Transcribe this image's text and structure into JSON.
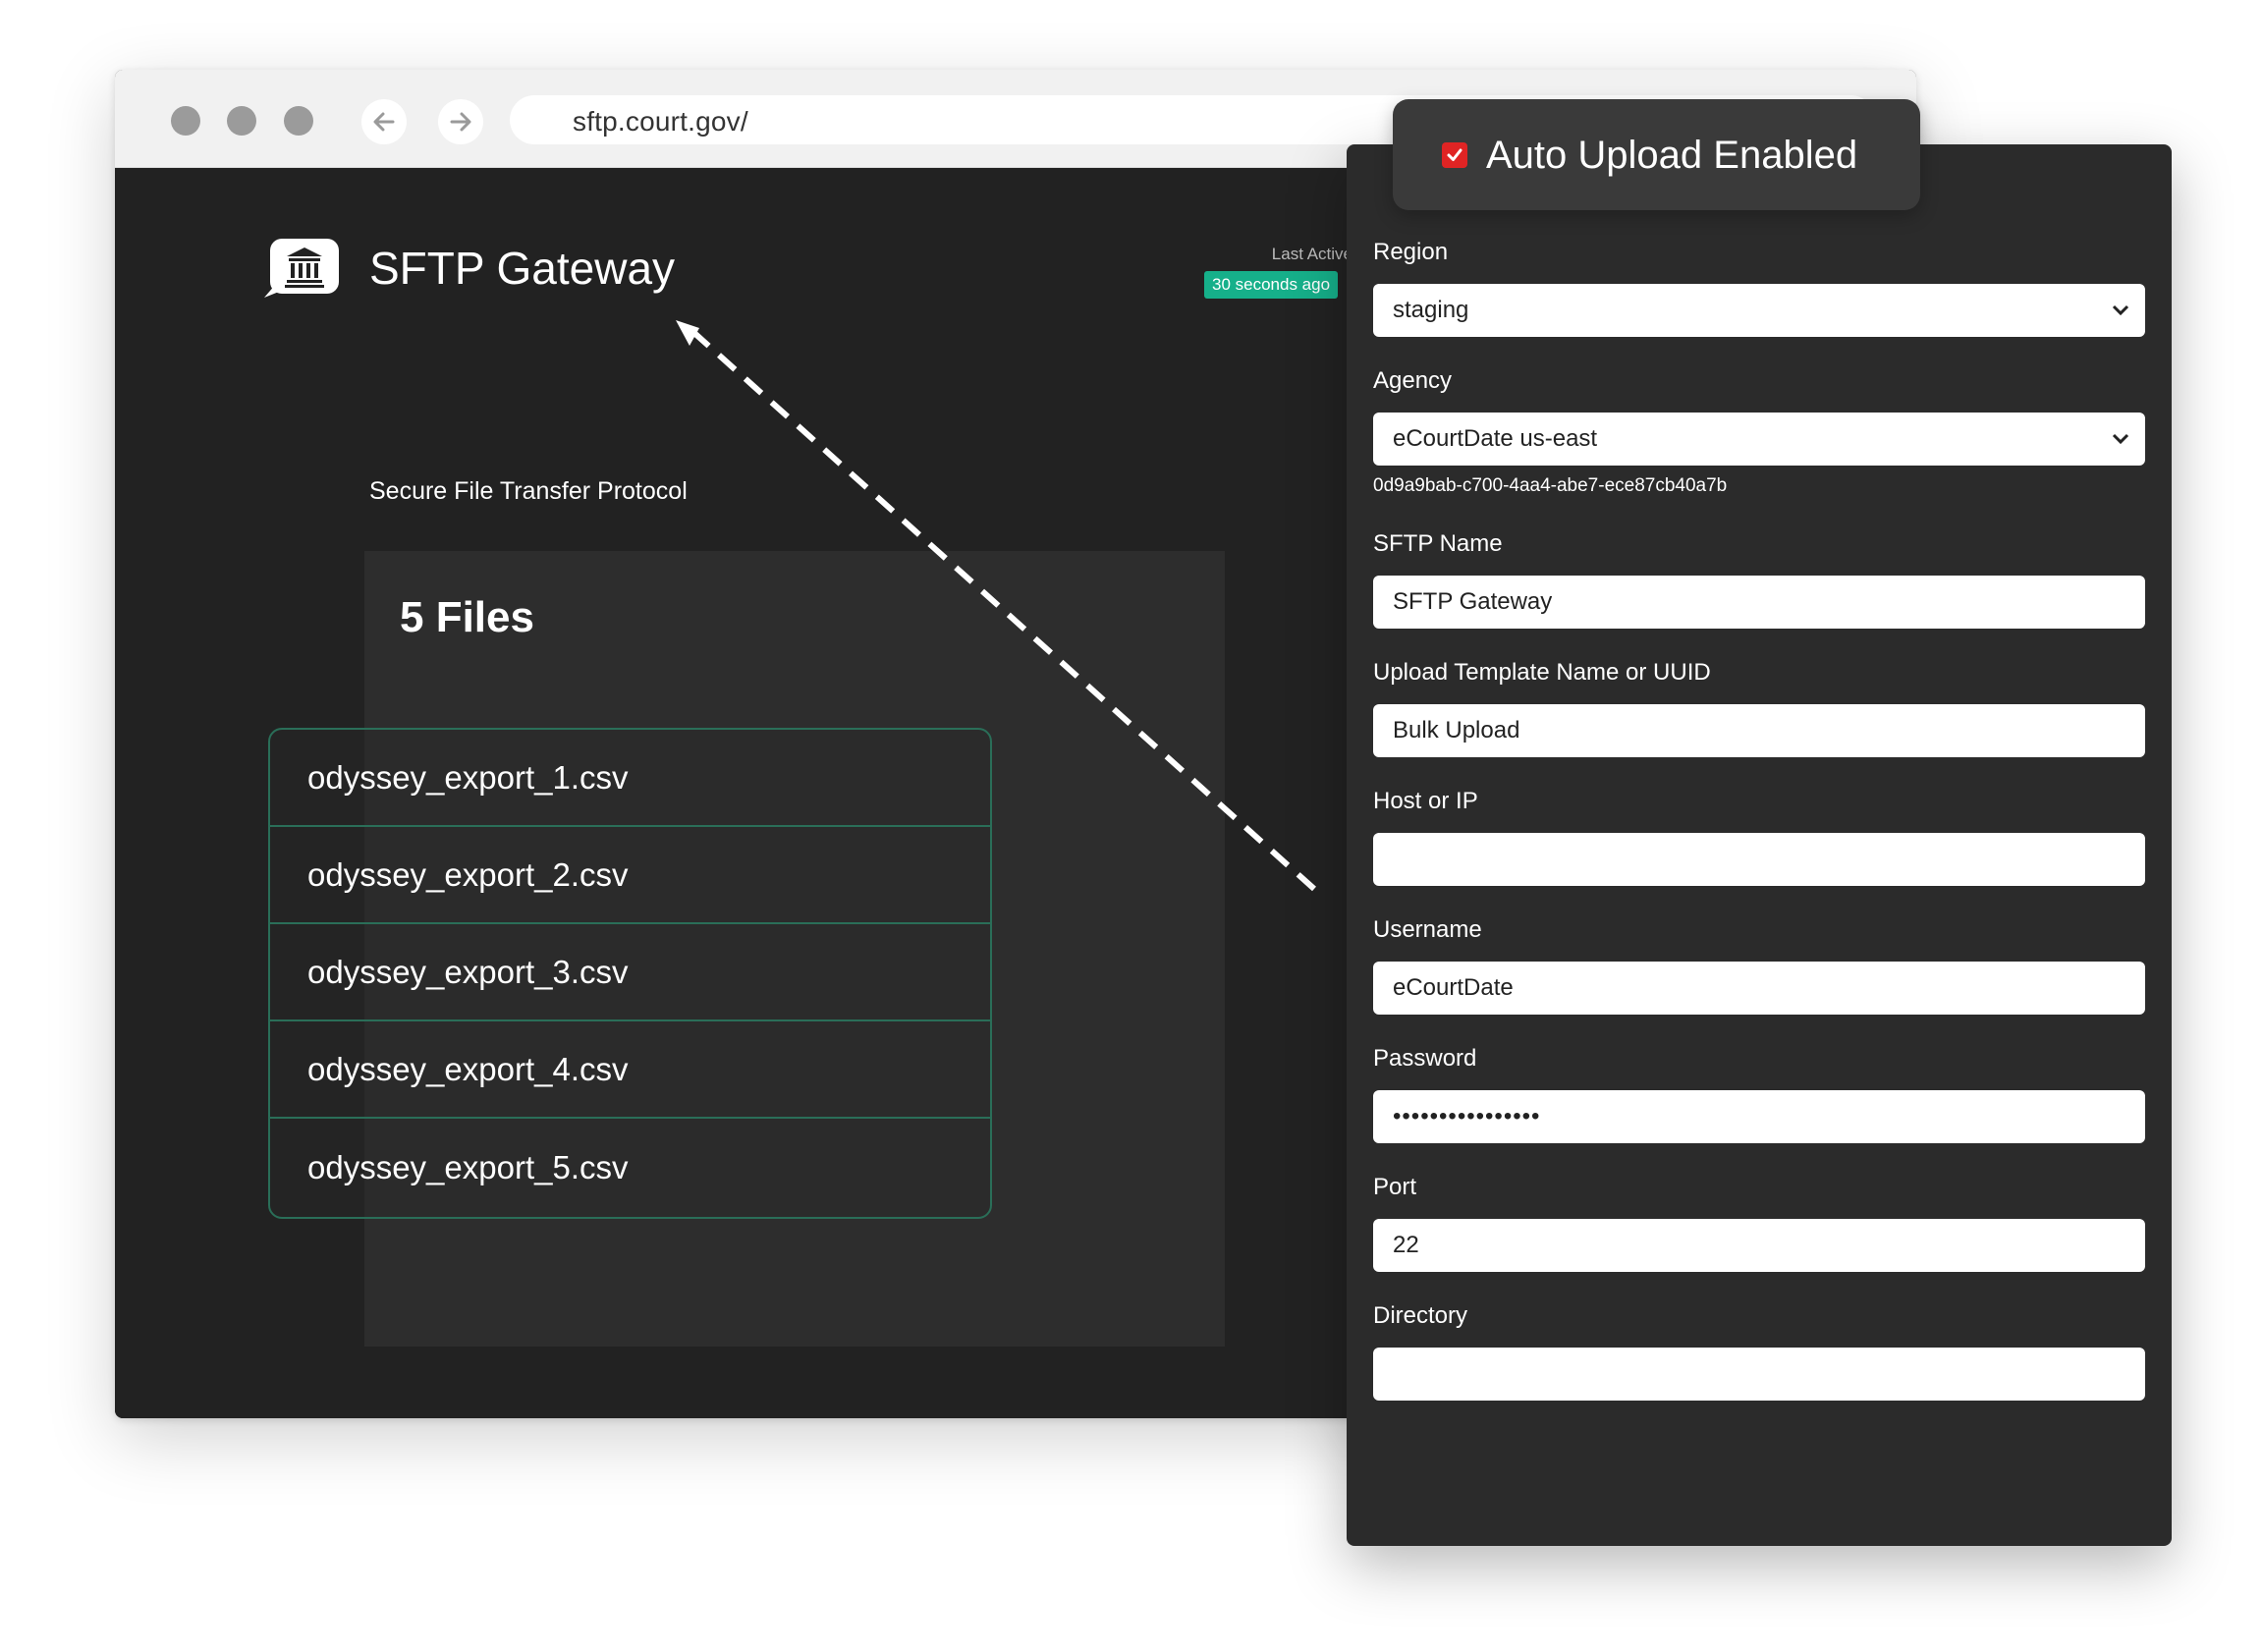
{
  "browser": {
    "url": "sftp.court.gov/"
  },
  "app": {
    "title": "SFTP Gateway",
    "subtitle": "Secure File Transfer Protocol",
    "last_active_label": "Last Active",
    "last_active_value": "30 seconds ago"
  },
  "files": {
    "heading": "5 Files",
    "items": [
      "odyssey_export_1.csv",
      "odyssey_export_2.csv",
      "odyssey_export_3.csv",
      "odyssey_export_4.csv",
      "odyssey_export_5.csv"
    ]
  },
  "settings": {
    "auto_upload_label": "Auto Upload Enabled",
    "auto_upload_checked": true,
    "region_label": "Region",
    "region_value": "staging",
    "agency_label": "Agency",
    "agency_value": "eCourtDate us-east",
    "agency_uuid": "0d9a9bab-c700-4aa4-abe7-ece87cb40a7b",
    "sftp_name_label": "SFTP Name",
    "sftp_name_value": "SFTP Gateway",
    "template_label": "Upload Template Name or UUID",
    "template_value": "Bulk Upload",
    "host_label": "Host or IP",
    "host_value": "",
    "username_label": "Username",
    "username_value": "eCourtDate",
    "password_label": "Password",
    "password_value": "••••••••••••••••",
    "port_label": "Port",
    "port_value": "22",
    "directory_label": "Directory",
    "directory_value": ""
  },
  "colors": {
    "badge_green": "#16b08a",
    "checkbox_red": "#e02424",
    "list_border": "#2a6e58",
    "page_dark": "#222222"
  }
}
